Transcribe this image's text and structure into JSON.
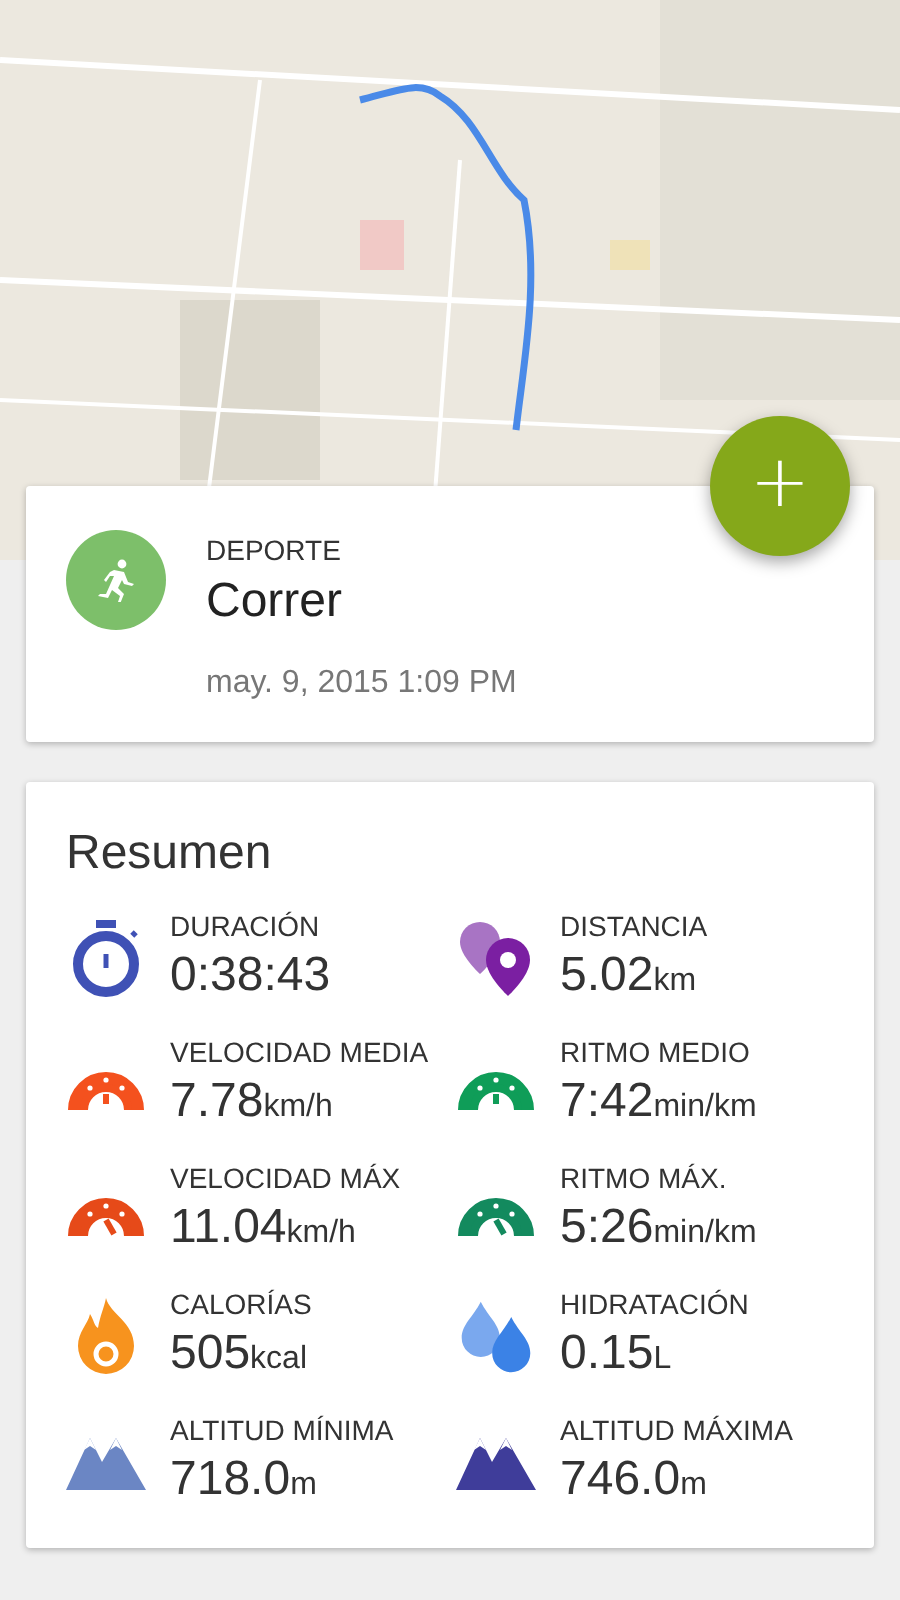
{
  "fab": {
    "label": "+"
  },
  "activity": {
    "label": "DEPORTE",
    "sport": "Correr",
    "date": "may. 9, 2015 1:09 PM"
  },
  "summary": {
    "title": "Resumen",
    "metrics": [
      {
        "kind": "stopwatch",
        "color": "#3f51b5",
        "label": "DURACIÓN",
        "value": "0:38:43"
      },
      {
        "kind": "pins",
        "color": "#7b1fa2",
        "label": "DISTANCIA",
        "value": "5.02",
        "unit": "km"
      },
      {
        "kind": "gauge",
        "color": "#f4511e",
        "label": "VELOCIDAD MEDIA",
        "value": "7.78",
        "unit": "km/h"
      },
      {
        "kind": "gauge",
        "color": "#0f9d58",
        "label": "RITMO MEDIO",
        "value": "7:42",
        "unit": "min/km"
      },
      {
        "kind": "gauge-max",
        "color": "#e64a19",
        "label": "VELOCIDAD MÁX",
        "value": "11.04",
        "unit": "km/h"
      },
      {
        "kind": "gauge-max",
        "color": "#138a5e",
        "label": "RITMO MÁX.",
        "value": "5:26",
        "unit": "min/km"
      },
      {
        "kind": "flame",
        "color": "#f7931e",
        "label": "CALORÍAS",
        "value": "505",
        "unit": "kcal"
      },
      {
        "kind": "drops",
        "color": "#3b82e6",
        "label": "HIDRATACIÓN",
        "value": "0.15",
        "unit": "L"
      },
      {
        "kind": "mountains",
        "color": "#6b86c4",
        "label": "ALTITUD MÍNIMA",
        "value": "718.0",
        "unit": "m"
      },
      {
        "kind": "mountains",
        "color": "#3f3d9a",
        "label": "ALTITUD MÁXIMA",
        "value": "746.0",
        "unit": "m"
      }
    ]
  }
}
